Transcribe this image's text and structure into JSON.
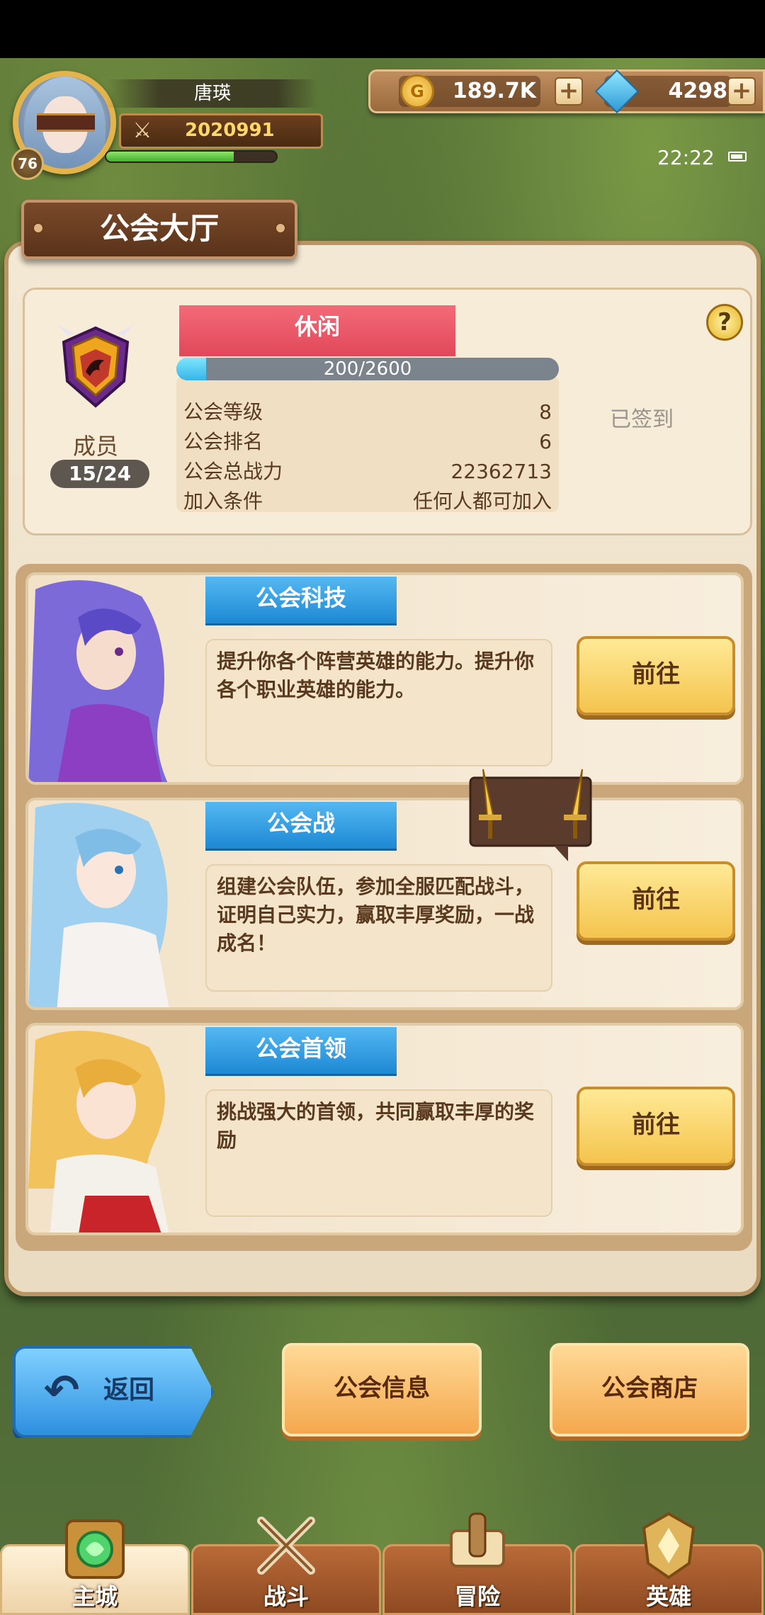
{
  "player": {
    "name": "唐瑛",
    "level": "76",
    "power": "2020991",
    "exp_fraction": 0.75
  },
  "currency": {
    "gold": "189.7K",
    "gems": "4298"
  },
  "status": {
    "time": "22:22"
  },
  "page_title": "公会大厅",
  "guild": {
    "type_label": "休闲",
    "progress_text": "200/2600",
    "progress_fraction": 0.077,
    "members_label": "成员",
    "members_count": "15/24",
    "signed_in": "已签到",
    "help": "?",
    "stats": [
      {
        "label": "公会等级",
        "value": "8"
      },
      {
        "label": "公会排名",
        "value": "6"
      },
      {
        "label": "公会总战力",
        "value": "22362713"
      },
      {
        "label": "加入条件",
        "value": "任何人都可加入"
      }
    ]
  },
  "features": [
    {
      "tag": "公会科技",
      "description": "提升你各个阵营英雄的能力。提升你各个职业英雄的能力。",
      "button": "前往"
    },
    {
      "tag": "公会战",
      "description": "组建公会队伍，参加全服匹配战斗，证明自己实力，赢取丰厚奖励，一战成名！",
      "button": "前往"
    },
    {
      "tag": "公会首领",
      "description": "挑战强大的首领，共同赢取丰厚的奖励",
      "button": "前往"
    }
  ],
  "bottom_buttons": {
    "back": "返回",
    "guild_info": "公会信息",
    "guild_shop": "公会商店"
  },
  "nav": [
    {
      "label": "主城",
      "icon": "castle-icon",
      "active": true
    },
    {
      "label": "战斗",
      "icon": "crossed-swords-icon",
      "active": false
    },
    {
      "label": "冒险",
      "icon": "scroll-map-icon",
      "active": false
    },
    {
      "label": "英雄",
      "icon": "hero-helmet-icon",
      "active": false
    }
  ],
  "colors": {
    "accent_red": "#e1485a",
    "tag_blue": "#1d88d4",
    "button_gold": "#f4c44d",
    "back_blue": "#2e8fe0"
  }
}
